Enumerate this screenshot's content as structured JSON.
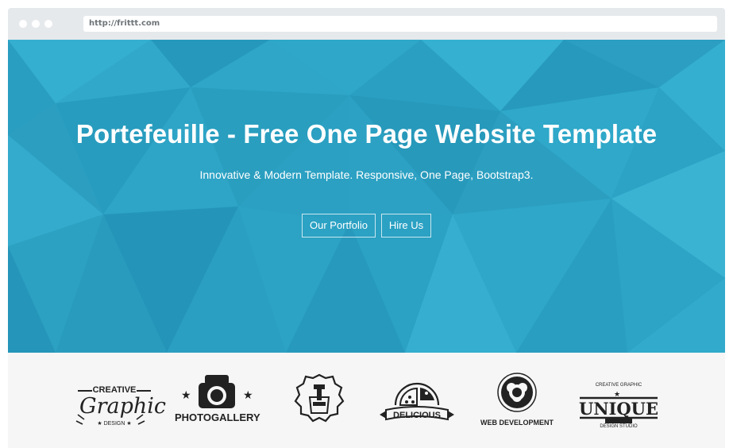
{
  "browser": {
    "url": "http://frittt.com"
  },
  "hero": {
    "title": "Portefeuille - Free One Page Website Template",
    "subtitle": "Innovative & Modern Template. Responsive, One Page, Bootstrap3.",
    "buttons": {
      "portfolio": "Our Portfolio",
      "hire": "Hire Us"
    },
    "background_color": "#2ba3c4"
  },
  "logos": {
    "creative": {
      "top": "CREATIVE",
      "script": "Graphic",
      "bottom": "★ DESIGN ★"
    },
    "photogallery": {
      "label": "PHOTOGALLERY"
    },
    "apron": {},
    "delicious": {
      "label": "DELICIOUS"
    },
    "webdev": {
      "label": "WEB DEVELOPMENT"
    },
    "unique": {
      "top": "CREATIVE GRAPHIC",
      "label": "UNIQUE",
      "bottom": "DESIGN STUDIO"
    }
  }
}
